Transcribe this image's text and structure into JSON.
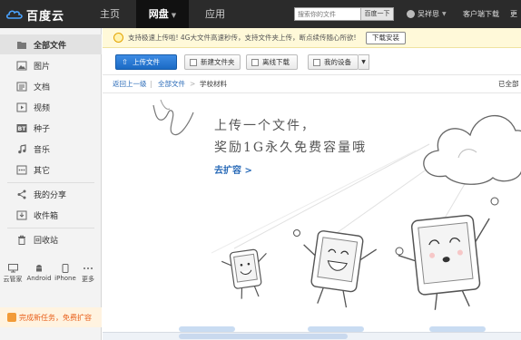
{
  "app": {
    "logo_text": "百度云",
    "nav": [
      {
        "label": "主页"
      },
      {
        "label": "网盘",
        "active": true
      },
      {
        "label": "应用"
      }
    ],
    "search": {
      "placeholder": "搜索你的文件",
      "button": "百度一下"
    },
    "user": {
      "name": "吴祥恩"
    },
    "links": {
      "client_download": "客户端下载",
      "more": "更"
    }
  },
  "sidebar": {
    "items": [
      {
        "label": "全部文件",
        "icon": "folder-icon",
        "active": true
      },
      {
        "label": "图片",
        "icon": "image-icon"
      },
      {
        "label": "文档",
        "icon": "document-icon"
      },
      {
        "label": "视频",
        "icon": "video-icon"
      },
      {
        "label": "种子",
        "icon": "bt-icon"
      },
      {
        "label": "音乐",
        "icon": "music-icon"
      },
      {
        "label": "其它",
        "icon": "more-dots-icon"
      },
      {
        "label": "我的分享",
        "icon": "share-icon"
      },
      {
        "label": "收件箱",
        "icon": "inbox-icon"
      },
      {
        "label": "回收站",
        "icon": "trash-icon"
      }
    ],
    "devices": [
      {
        "label": "云管家",
        "icon": "pc-icon"
      },
      {
        "label": "Android",
        "icon": "android-icon"
      },
      {
        "label": "iPhone",
        "icon": "iphone-icon"
      },
      {
        "label": "更多",
        "icon": "more-icon"
      }
    ],
    "promo": "完成新任务，免费扩容"
  },
  "notice": {
    "text": "支持极速上传啦! 4G大文件高速秒传，支持文件夹上传，断点续传随心所欲!",
    "button": "下载安装"
  },
  "toolbar": {
    "upload": "上传文件",
    "new_folder": "新建文件夹",
    "offline_download": "离线下载",
    "my_devices": "我的设备"
  },
  "breadcrumb": {
    "back": "返回上一级",
    "root": "全部文件",
    "separator": ">",
    "current": "学校材料",
    "right_text": "已全部"
  },
  "empty_state": {
    "line1": "上传一个文件，",
    "line2": "奖励1G永久免费容量哦",
    "cta": "去扩容 >"
  },
  "colors": {
    "topbar": "#2b2b2b",
    "accent_blue": "#1b6ac4",
    "notice_bg": "#fff9d9",
    "promo_orange": "#e8601c"
  }
}
